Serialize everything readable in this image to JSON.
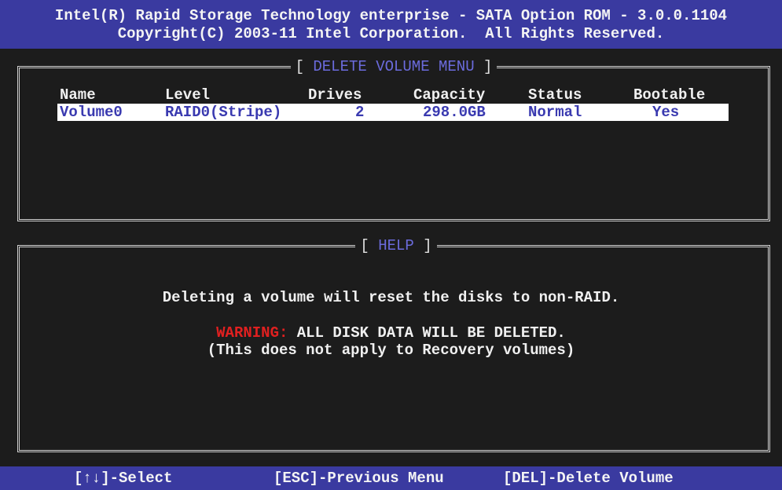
{
  "header": {
    "line1": "Intel(R) Rapid Storage Technology enterprise - SATA Option ROM - 3.0.0.1104",
    "line2": "Copyright(C) 2003-11 Intel Corporation.  All Rights Reserved."
  },
  "delete_menu": {
    "title": "DELETE VOLUME MENU",
    "columns": [
      "Name",
      "Level",
      "Drives",
      "Capacity",
      "Status",
      "Bootable"
    ],
    "rows": [
      {
        "name": "Volume0",
        "level": "RAID0(Stripe)",
        "drives": "2",
        "capacity": "298.0GB",
        "status": "Normal",
        "bootable": "Yes"
      }
    ]
  },
  "help": {
    "title": "HELP",
    "line1": "Deleting a volume will reset the disks to non-RAID.",
    "warning_label": "WARNING:",
    "warning_text": " ALL DISK DATA WILL BE DELETED.",
    "line3": "(This does not apply to Recovery volumes)"
  },
  "footer": {
    "select": "[↑↓]-Select",
    "previous": "[ESC]-Previous Menu",
    "delete": "[DEL]-Delete Volume"
  },
  "colors": {
    "bar_blue": "#3a3aa0",
    "background": "#1c1c1c",
    "highlight": "#ffffff",
    "title_blue": "#6b6bdc",
    "warning_red": "#e02020"
  }
}
